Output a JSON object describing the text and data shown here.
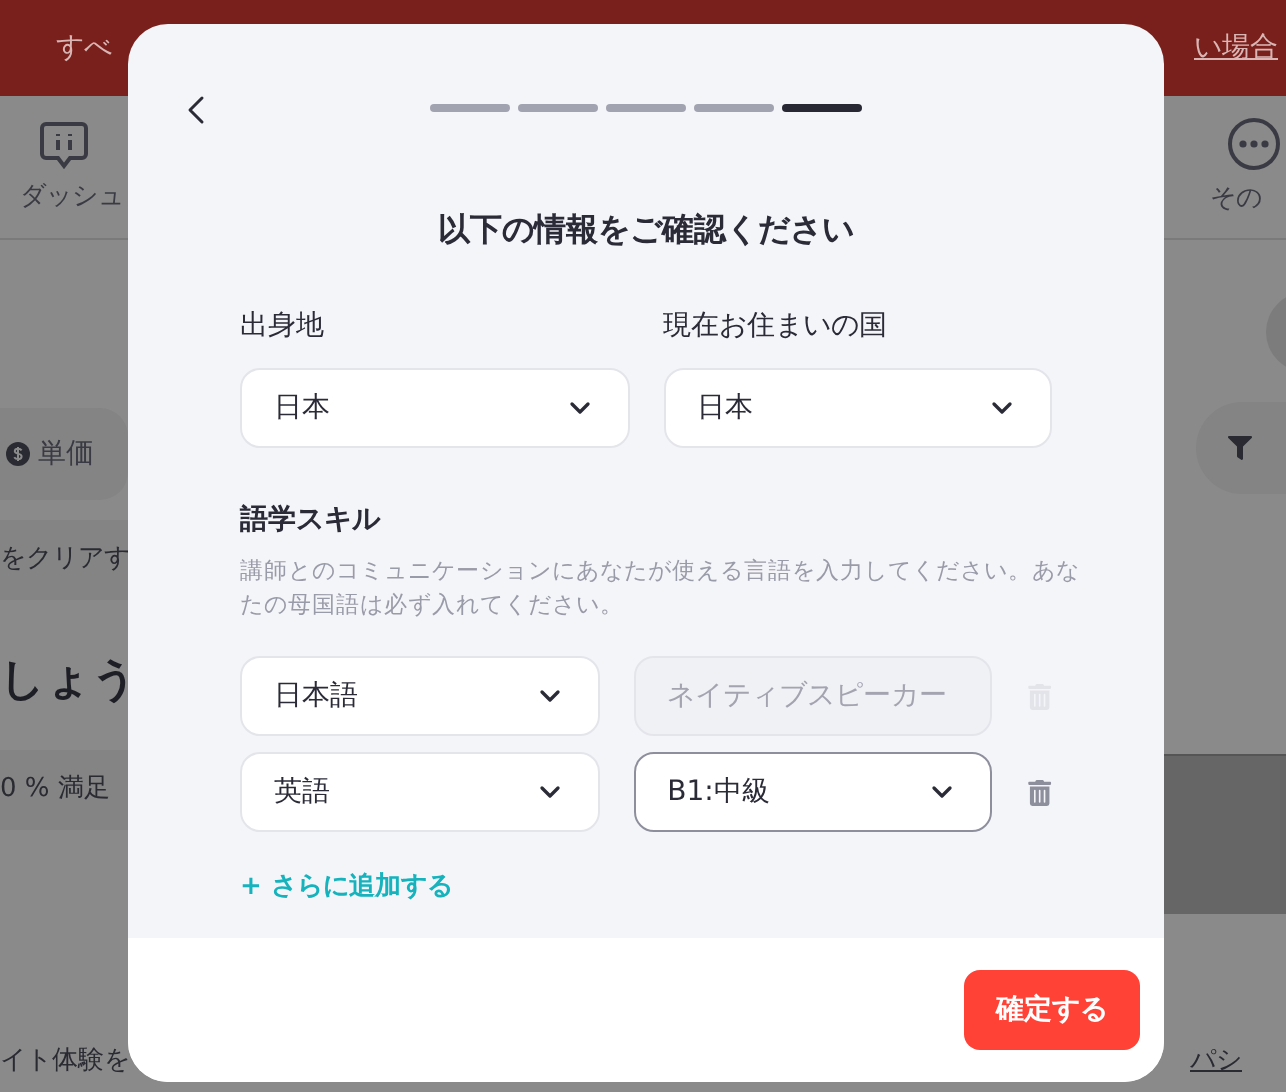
{
  "banner": {
    "left_text": "すべ",
    "right_link": "い場合"
  },
  "nav": {
    "left_item": "ダッシュ",
    "right_item": "その"
  },
  "background": {
    "price_filter": "単価",
    "clear_text": "をクリアす",
    "heading": "しょう",
    "guarantee": "0 % 満足",
    "footer_text": "イト体験を",
    "footer_link": "パシ"
  },
  "modal": {
    "steps": [
      {
        "current": false
      },
      {
        "current": false
      },
      {
        "current": false
      },
      {
        "current": false
      },
      {
        "current": true
      }
    ],
    "title": "以下の情報をご確認ください",
    "fields": [
      {
        "label": "出身地",
        "value": "日本"
      },
      {
        "label": "現在お住まいの国",
        "value": "日本"
      }
    ],
    "languages": {
      "title": "語学スキル",
      "description": "講師とのコミュニケーションにあなたが使える言語を入力してください。あなたの母国語は必ず入れてください。",
      "rows": [
        {
          "language": "日本語",
          "proficiency": "ネイティブスピーカー",
          "disabled": true
        },
        {
          "language": "英語",
          "proficiency": "B1:中級",
          "disabled": false
        }
      ],
      "add_link": "+ さらに追加する"
    },
    "confirm_button": "確定する"
  }
}
